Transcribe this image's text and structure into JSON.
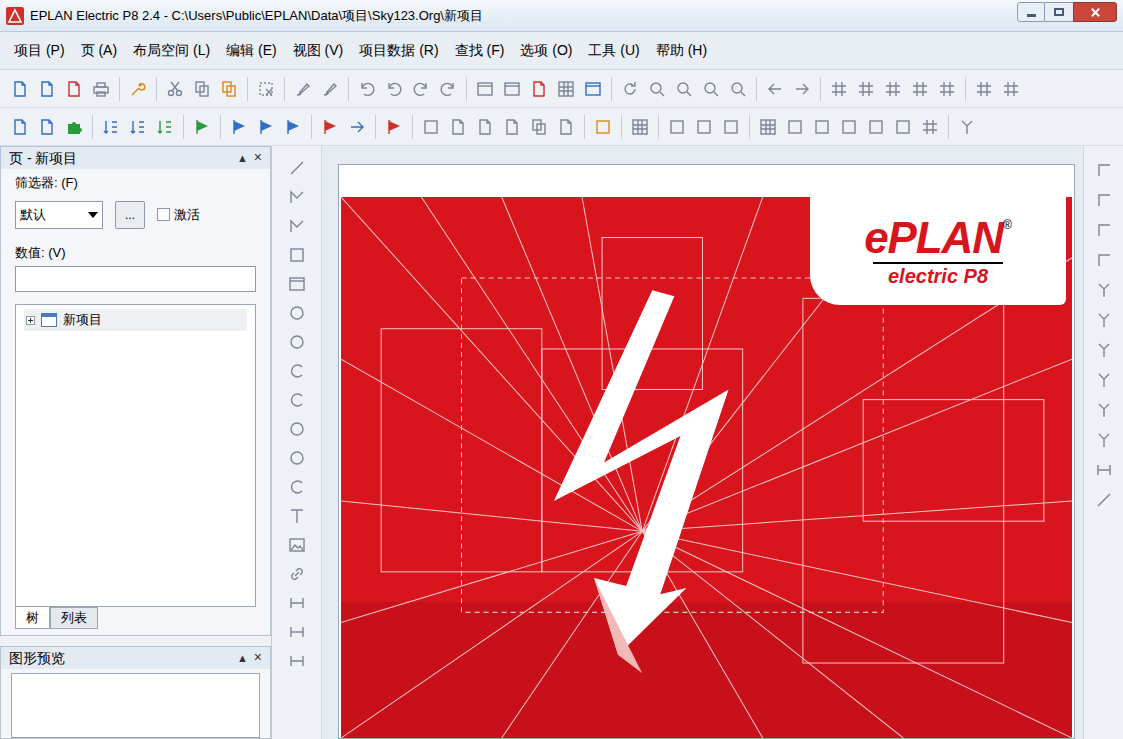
{
  "window": {
    "title": "EPLAN Electric P8 2.4 - C:\\Users\\Public\\EPLAN\\Data\\项目\\Sky123.Org\\新项目"
  },
  "menu": [
    "项目 (P)",
    "页 (A)",
    "布局空间 (L)",
    "编辑 (E)",
    "视图 (V)",
    "项目数据 (R)",
    "查找 (F)",
    "选项 (O)",
    "工具 (U)",
    "帮助 (H)"
  ],
  "page_panel": {
    "title": "页 - 新项目",
    "pin": "▲",
    "close": "×",
    "filter_label": "筛选器: (F)",
    "filter_value": "默认",
    "filter_button": "...",
    "activate": {
      "label": "激活",
      "checked": false
    },
    "value_label": "数值: (V)",
    "value": "",
    "tree": [
      {
        "label": "新项目",
        "expanded": false
      }
    ],
    "tabs": [
      {
        "label": "树",
        "selected": true
      },
      {
        "label": "列表",
        "selected": false
      }
    ]
  },
  "preview_panel": {
    "title": "图形预览",
    "pin": "▲",
    "close": "×"
  },
  "logo": {
    "brand": "ePLAN",
    "mark": "®",
    "sub": "electric P8"
  }
}
